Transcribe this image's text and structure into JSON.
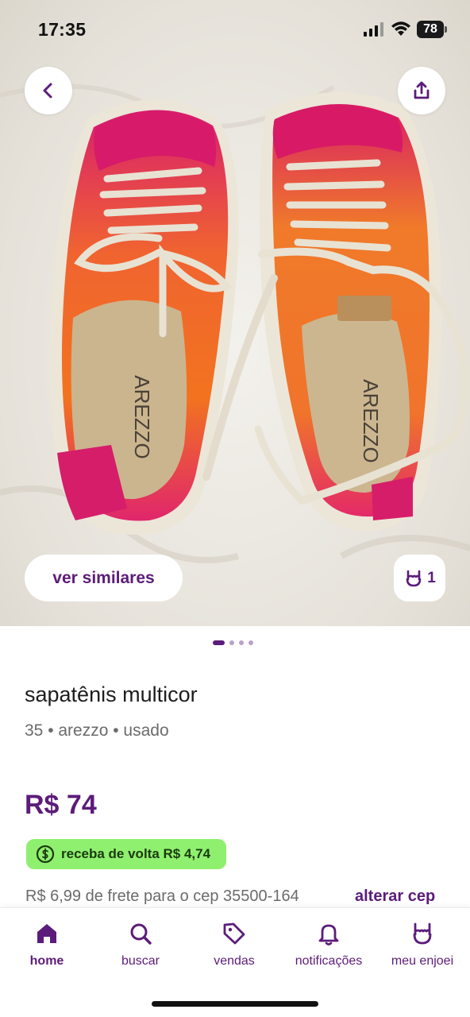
{
  "status_bar": {
    "time": "17:35",
    "battery": "78"
  },
  "photo": {
    "brand_print": "AREZZO",
    "similar_label": "ver similares",
    "likes_count": "1"
  },
  "pagination": {
    "total": 4,
    "active": 1
  },
  "product": {
    "title": "sapatênis multicor",
    "meta": "35 • arezzo • usado",
    "price": "R$ 74",
    "cashback": "receba de volta R$ 4,74",
    "shipping": "R$ 6,99 de frete para o cep 35500-164",
    "alter_cep": "alterar cep"
  },
  "bottom_nav": {
    "items": [
      {
        "label": "home",
        "icon": "home-icon",
        "active": true
      },
      {
        "label": "buscar",
        "icon": "search-icon",
        "active": false
      },
      {
        "label": "vendas",
        "icon": "tag-icon",
        "active": false
      },
      {
        "label": "notificações",
        "icon": "bell-icon",
        "active": false
      },
      {
        "label": "meu enjoei",
        "icon": "rock-hand-icon",
        "active": false
      }
    ]
  },
  "colors": {
    "brand": "#5c1c7a",
    "cashback_bg": "#8ff06f",
    "text_muted": "#6b6b6b"
  }
}
